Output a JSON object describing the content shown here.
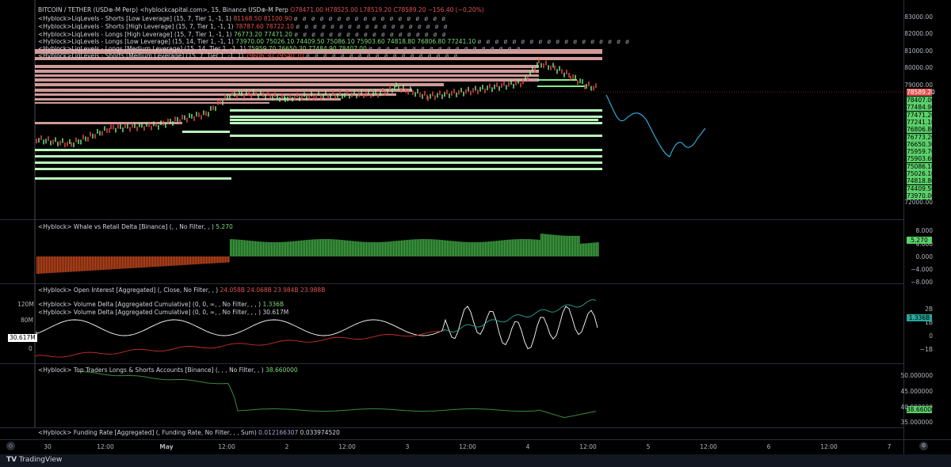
{
  "header": {
    "symbol": "BITCOIN / TETHER (USD⊕-M Perp) <hyblockcapital.com>, 15, Binance USD⊕-M Perp",
    "ohlc": "O78471.00 H78525.00 L78519.20 C78589.20 −156.40 (−0.20%)"
  },
  "indicators": [
    {
      "name": "<Hyblock>LiqLevels - Shorts [Low Leverage] (15, 7, Tier 1, -1, 1)",
      "v1": "81168.50",
      "v2": "81100.90",
      "c1": "r",
      "c2": "r"
    },
    {
      "name": "<Hyblock>LiqLevels - Shorts [High Leverage] (15, 7, Tier 1, -1, 1)",
      "v1": "78787.60",
      "v2": "78722.10",
      "c1": "r",
      "c2": "r"
    },
    {
      "name": "<Hyblock>LiqLevels - Longs [High Leverage] (15, 7, Tier 1, -1, 1)",
      "v1": "76773.20",
      "v2": "77471.20",
      "c1": "g",
      "c2": "g"
    },
    {
      "name": "<Hyblock>LiqLevels - Longs [Low Leverage] (15, 14, Tier 1, -1, 1)",
      "v1": "73970.00  75026.10  74409.50  75086.10  75903.60  74818.80  76806.80  77241.10",
      "v2": "",
      "c1": "g",
      "c2": "g"
    },
    {
      "name": "<Hyblock>LiqLevels - Longs [Medium Leverage] (15, 14, Tier 1, -1, 1)",
      "v1": "75959.70  76650.30  77484.90  78407.00",
      "v2": "",
      "c1": "g",
      "c2": "g"
    },
    {
      "name": "<Hyblock>LiqLevels - Shorts [Medium Leverage] (15, 7, Tier 1, -1, 1)",
      "v1": "79606.30",
      "v2": "79540.10",
      "c1": "r",
      "c2": "r"
    }
  ],
  "placeholder_glyph": "ø ø ø ø ø ø ø ø ø ø ø ø ø ø ø ø ø ø",
  "price_axis": {
    "ticks": [
      "83000.00",
      "82000.00",
      "81000.00",
      "80000.00",
      "79000.00",
      "72000.00"
    ],
    "labels": [
      {
        "text": "78589.20",
        "color": "#e0534f"
      },
      {
        "text": "78407.00",
        "color": "#5bd06a"
      },
      {
        "text": "77484.90",
        "color": "#5bd06a"
      },
      {
        "text": "77471.20",
        "color": "#5bd06a"
      },
      {
        "text": "77241.10",
        "color": "#5bd06a"
      },
      {
        "text": "76806.80",
        "color": "#5bd06a"
      },
      {
        "text": "76773.20",
        "color": "#5bd06a"
      },
      {
        "text": "76650.30",
        "color": "#5bd06a"
      },
      {
        "text": "75959.70",
        "color": "#5bd06a"
      },
      {
        "text": "75903.60",
        "color": "#5bd06a"
      },
      {
        "text": "75086.10",
        "color": "#5bd06a"
      },
      {
        "text": "75026.10",
        "color": "#5bd06a"
      },
      {
        "text": "74818.80",
        "color": "#5bd06a"
      },
      {
        "text": "74409.50",
        "color": "#5bd06a"
      },
      {
        "text": "73970.00",
        "color": "#5bd06a"
      }
    ]
  },
  "whale": {
    "title": "<Hyblock> Whale vs Retail Delta [Binance] (, , No Filter, , )",
    "value": "5.270",
    "ticks": [
      "8.000",
      "4.000",
      "0.000",
      "−4.000",
      "−8.000"
    ],
    "label": "5.270"
  },
  "oi": {
    "title": "<Hyblock> Open Interest [Aggregated] (, Close, No Filter, , )",
    "values": "24.058B  24.068B  23.984B  23.988B"
  },
  "vd1": {
    "title": "<Hyblock> Volume Delta [Aggregated Cumulative] (0, 0, ∞, , No Filter, , , )",
    "value": "1.336B"
  },
  "vd2": {
    "title": "<Hyblock> Volume Delta [Aggregated Cumulative] (0, 0, ∞, , No Filter, , , )",
    "value": "30.617M"
  },
  "vd_left_ticks": [
    "120M",
    "80M",
    "0"
  ],
  "vd_left_label": "30.617M",
  "vd_right_ticks": [
    "2B",
    "1B",
    "0",
    "−1B"
  ],
  "vd_right_label": "1.336B",
  "top_traders": {
    "title": "<Hyblock> Top Traders Longs & Shorts Accounts [Binance] (, , , No Filter, , )",
    "value": "38.660000",
    "ticks": [
      "50.000000",
      "45.000000",
      "40.000000",
      "35.000000"
    ],
    "label": "38.660000"
  },
  "funding": {
    "title": "<Hyblock> Funding Rate [Aggregated] (, Funding Rate, No Filter, , , Sum)",
    "v1": "0.012166307",
    "v2": "0.033974520"
  },
  "time_axis": [
    "30",
    "12:00",
    "May",
    "12:00",
    "2",
    "12:00",
    "3",
    "12:00",
    "4",
    "12:00",
    "5",
    "12:00",
    "6",
    "12:00",
    "7"
  ],
  "footer": {
    "brand": "TradingView"
  },
  "colors": {
    "green": "#5bd06a",
    "red": "#e0534f",
    "projection": "#2fa8d8"
  }
}
